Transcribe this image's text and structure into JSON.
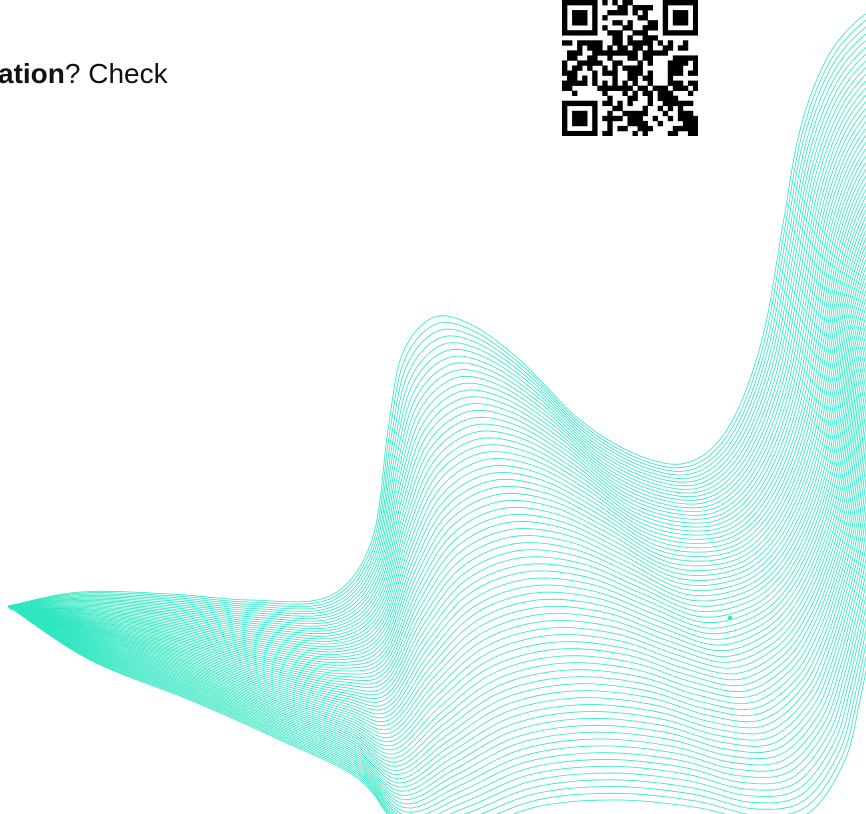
{
  "headline": {
    "bold_text": "ation",
    "rest_text": "? Check"
  },
  "colors": {
    "wave_accent": "#2ee6c0",
    "text": "#111111",
    "qr_dark": "#000000"
  },
  "icons": {
    "qr": "qr-code-icon"
  }
}
